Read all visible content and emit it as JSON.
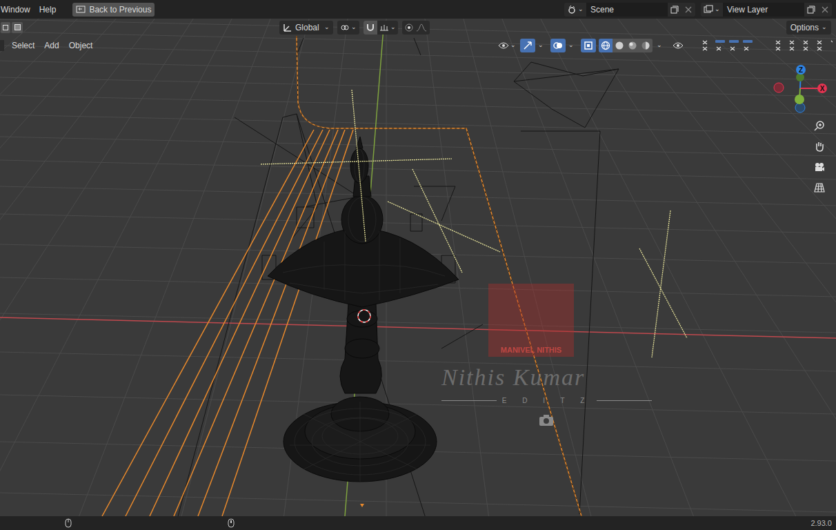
{
  "topbar": {
    "menus": [
      "Window",
      "Help"
    ],
    "back_button": "Back to Previous",
    "scene": "Scene",
    "view_layer": "View Layer"
  },
  "tool_header": {
    "orientation": "Global",
    "options": "Options"
  },
  "viewport_header": {
    "menus": [
      "Select",
      "Add",
      "Object"
    ],
    "toggles": [
      {
        "kind": "gizmo",
        "on": true
      },
      {
        "kind": "overlay",
        "on": true
      },
      {
        "kind": "xray",
        "on": true
      }
    ],
    "shading": [
      {
        "kind": "wireframe",
        "selected": true
      },
      {
        "kind": "solid",
        "selected": false
      },
      {
        "kind": "material",
        "selected": false
      },
      {
        "kind": "rendered",
        "selected": false
      }
    ]
  },
  "gizmo": {
    "axes": [
      {
        "label": "Z",
        "color": "#2f83e3"
      },
      {
        "label": "X",
        "color": "#e53451"
      }
    ]
  },
  "watermark": {
    "name": "MANIVEL NITHIS",
    "signature": "Nithis Kumar",
    "tagline": "E D I T Z"
  },
  "status_bar": {
    "version": "2.93.0"
  }
}
